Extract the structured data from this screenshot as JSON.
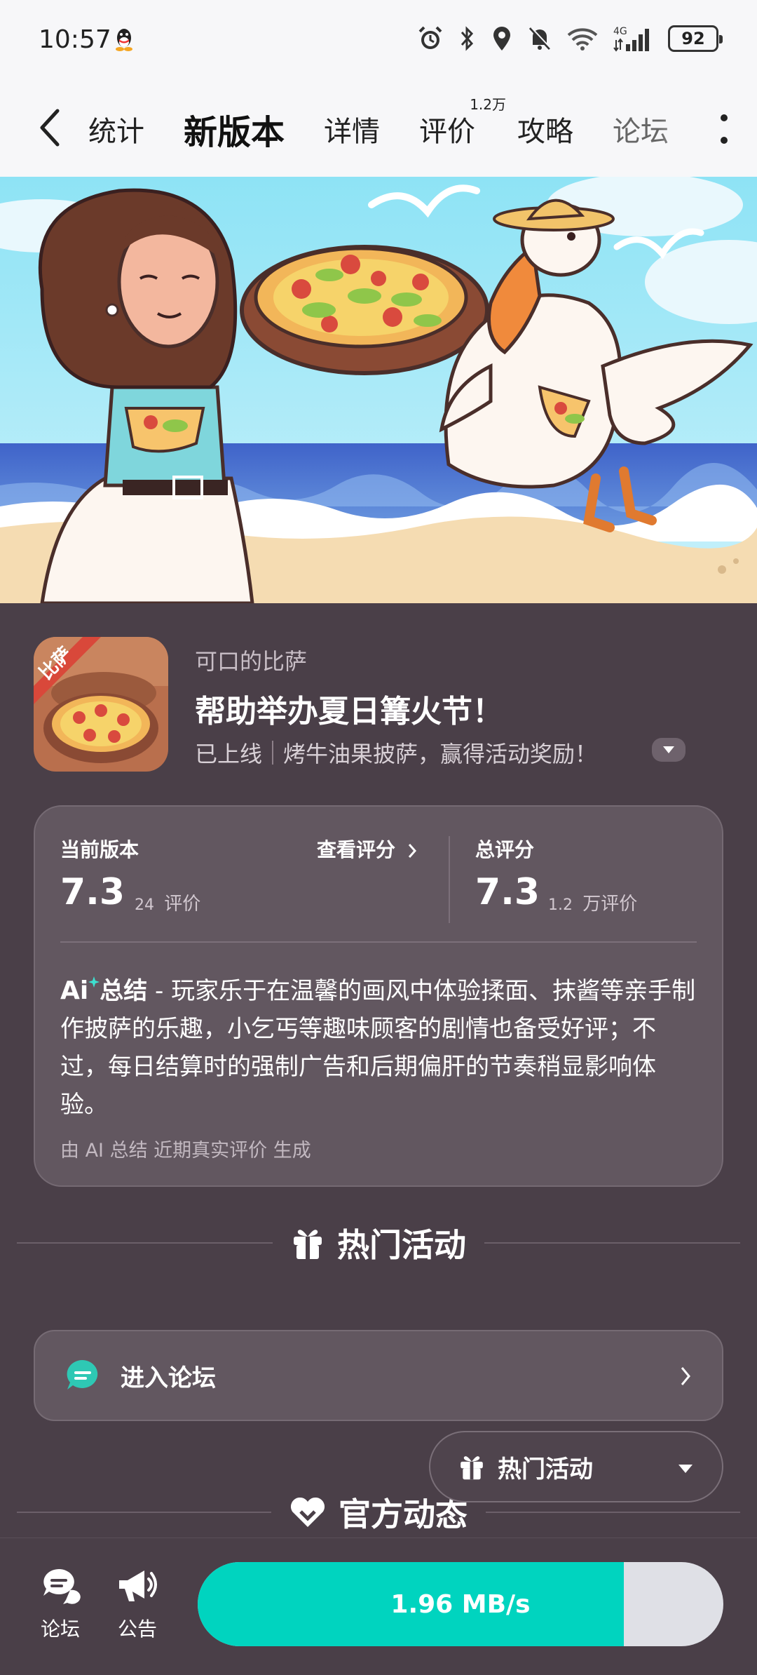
{
  "status_bar": {
    "time": "10:57",
    "battery": "92",
    "network": "4G"
  },
  "nav": {
    "tabs": [
      {
        "label": "统计"
      },
      {
        "label": "新版本"
      },
      {
        "label": "详情"
      },
      {
        "label": "评价",
        "badge": "1.2万"
      },
      {
        "label": "攻略"
      },
      {
        "label": "论坛"
      }
    ],
    "active_tab": "新版本"
  },
  "app": {
    "name": "可口的比萨",
    "icon_badge": "比萨",
    "title": "帮助举办夏日篝火节！",
    "status": "已上线",
    "description": "烤牛油果披萨，赢得活动奖励！"
  },
  "rating": {
    "current_label": "当前版本",
    "view_reviews": "查看评分",
    "current_score": "7.3",
    "current_count": "24",
    "current_count_unit": "评价",
    "total_label": "总评分",
    "total_score": "7.3",
    "total_count": "1.2",
    "total_count_unit": "万评价",
    "ai_badge": "Ai",
    "ai_title": "总结",
    "ai_text": " - 玩家乐于在温馨的画风中体验揉面、抹酱等亲手制作披萨的乐趣，小乞丐等趣味顾客的剧情也备受好评；不过，每日结算时的强制广告和后期偏肝的节奏稍显影响体验。",
    "ai_note": "由 AI 总结 近期真实评价 生成"
  },
  "sections": {
    "hot_events": "热门活动",
    "official_news": "官方动态"
  },
  "forum_entry": {
    "label": "进入论坛"
  },
  "floating_dropdown": {
    "label": "热门活动"
  },
  "bottom_bar": {
    "forum": "论坛",
    "notice": "公告",
    "download_speed": "1.96 MB/s",
    "download_progress": 0.81
  },
  "colors": {
    "accent": "#00d4bf",
    "page_bg": "#4a3f48",
    "card_bg": "#625760"
  }
}
